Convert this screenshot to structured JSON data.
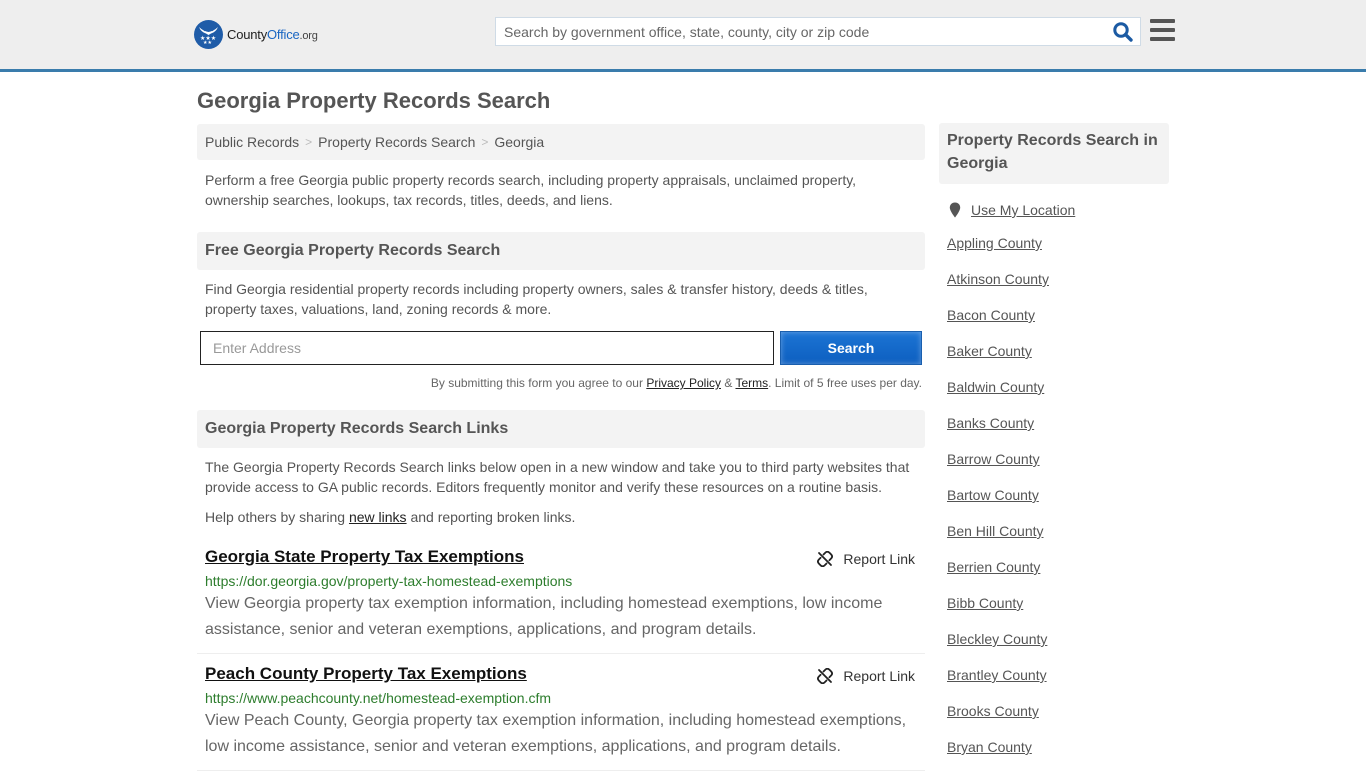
{
  "header": {
    "logo": {
      "brand_part1": "County",
      "brand_part2": "Office",
      "brand_tld": ".org"
    },
    "search": {
      "placeholder": "Search by government office, state, county, city or zip code",
      "value": ""
    },
    "search_icon": "search-icon",
    "menu_icon": "hamburger-menu-icon"
  },
  "page": {
    "title": "Georgia Property Records Search"
  },
  "breadcrumb": [
    {
      "label": "Public Records"
    },
    {
      "label": "Property Records Search"
    },
    {
      "label": "Georgia"
    }
  ],
  "breadcrumb_separator": ">",
  "intro": "Perform a free Georgia public property records search, including property appraisals, unclaimed property, ownership searches, lookups, tax records, titles, deeds, and liens.",
  "free_search": {
    "heading": "Free Georgia Property Records Search",
    "description": "Find Georgia residential property records including property owners, sales & transfer history, deeds & titles, property taxes, valuations, land, zoning records & more.",
    "address_placeholder": "Enter Address",
    "address_value": "",
    "button_label": "Search",
    "disclaimer_prefix": "By submitting this form you agree to our ",
    "privacy_label": "Privacy Policy",
    "amp": " & ",
    "terms_label": "Terms",
    "disclaimer_suffix": ". Limit of 5 free uses per day."
  },
  "links_section": {
    "heading": "Georgia Property Records Search Links",
    "description": "The Georgia Property Records Search links below open in a new window and take you to third party websites that provide access to GA public records. Editors frequently monitor and verify these resources on a routine basis.",
    "help_prefix": "Help others by sharing ",
    "help_link": "new links",
    "help_suffix": " and reporting broken links.",
    "report_label": "Report Link",
    "items": [
      {
        "title": "Georgia State Property Tax Exemptions",
        "url": "https://dor.georgia.gov/property-tax-homestead-exemptions",
        "description": "View Georgia property tax exemption information, including homestead exemptions, low income assistance, senior and veteran exemptions, applications, and program details."
      },
      {
        "title": "Peach County Property Tax Exemptions",
        "url": "https://www.peachcounty.net/homestead-exemption.cfm",
        "description": "View Peach County, Georgia property tax exemption information, including homestead exemptions, low income assistance, senior and veteran exemptions, applications, and program details."
      }
    ]
  },
  "sidebar": {
    "heading": "Property Records Search in Georgia",
    "use_location": "Use My Location",
    "counties": [
      "Appling County",
      "Atkinson County",
      "Bacon County",
      "Baker County",
      "Baldwin County",
      "Banks County",
      "Barrow County",
      "Bartow County",
      "Ben Hill County",
      "Berrien County",
      "Bibb County",
      "Bleckley County",
      "Brantley County",
      "Brooks County",
      "Bryan County"
    ]
  },
  "colors": {
    "brand_blue": "#1f5ca8",
    "header_bg": "#eeeeee",
    "header_border": "#3a7cac",
    "button_blue": "#1c74d4",
    "url_green": "#2d7d2d",
    "text_gray": "#555555"
  }
}
